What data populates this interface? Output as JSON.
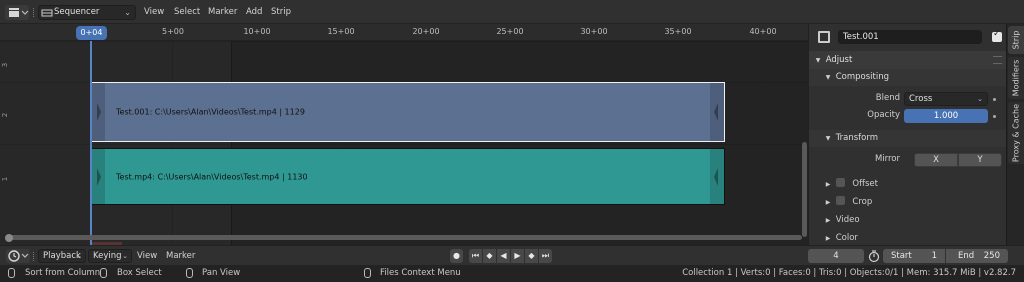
{
  "top_header": {
    "editor_mode": "Sequencer",
    "menus": [
      "View",
      "Select",
      "Marker",
      "Add",
      "Strip"
    ]
  },
  "timeline": {
    "current_frame": "0+04",
    "ruler_ticks": [
      "5+00",
      "10+00",
      "15+00",
      "20+00",
      "25+00",
      "30+00",
      "35+00",
      "40+00"
    ],
    "channels": [
      "3",
      "2",
      "1"
    ],
    "strips": [
      {
        "label": "Test.001: C:\\Users\\Alan\\Videos\\Test.mp4 | 1129",
        "color": "#5c7091",
        "selected": true
      },
      {
        "label": "Test.mp4: C:\\Users\\Alan\\Videos\\Test.mp4 | 1130",
        "color": "#2f9893",
        "selected": false
      }
    ]
  },
  "sidebar": {
    "strip_name": "Test.001",
    "adjust_panel": "Adjust",
    "compositing": {
      "title": "Compositing",
      "blend_label": "Blend",
      "blend_value": "Cross",
      "opacity_label": "Opacity",
      "opacity_value": "1.000"
    },
    "transform": {
      "title": "Transform",
      "mirror_label": "Mirror",
      "x_label": "X",
      "y_label": "Y"
    },
    "offset_label": "Offset",
    "crop_label": "Crop",
    "video_label": "Video",
    "color_label": "Color"
  },
  "tabs": [
    "Strip",
    "Modifiers",
    "Proxy & Cache"
  ],
  "bottom_header": {
    "playback_label": "Playback",
    "keying_label": "Keying",
    "view_label": "View",
    "marker_label": "Marker",
    "current_frame": "4",
    "start_label": "Start",
    "start_value": "1",
    "end_label": "End",
    "end_value": "250"
  },
  "status_bar": {
    "hint1": "Sort from Column",
    "hint2": "Box Select",
    "hint3": "Pan View",
    "hint4": "Files Context Menu",
    "stats": "Collection 1 | Verts:0 | Faces:0 | Tris:0 | Objects:0/1 | Mem: 315.7 MiB | v2.82.7"
  },
  "colors": {
    "accent": "#4772b3",
    "strip_selected": "#5c7091",
    "strip_movie": "#2f9893"
  }
}
